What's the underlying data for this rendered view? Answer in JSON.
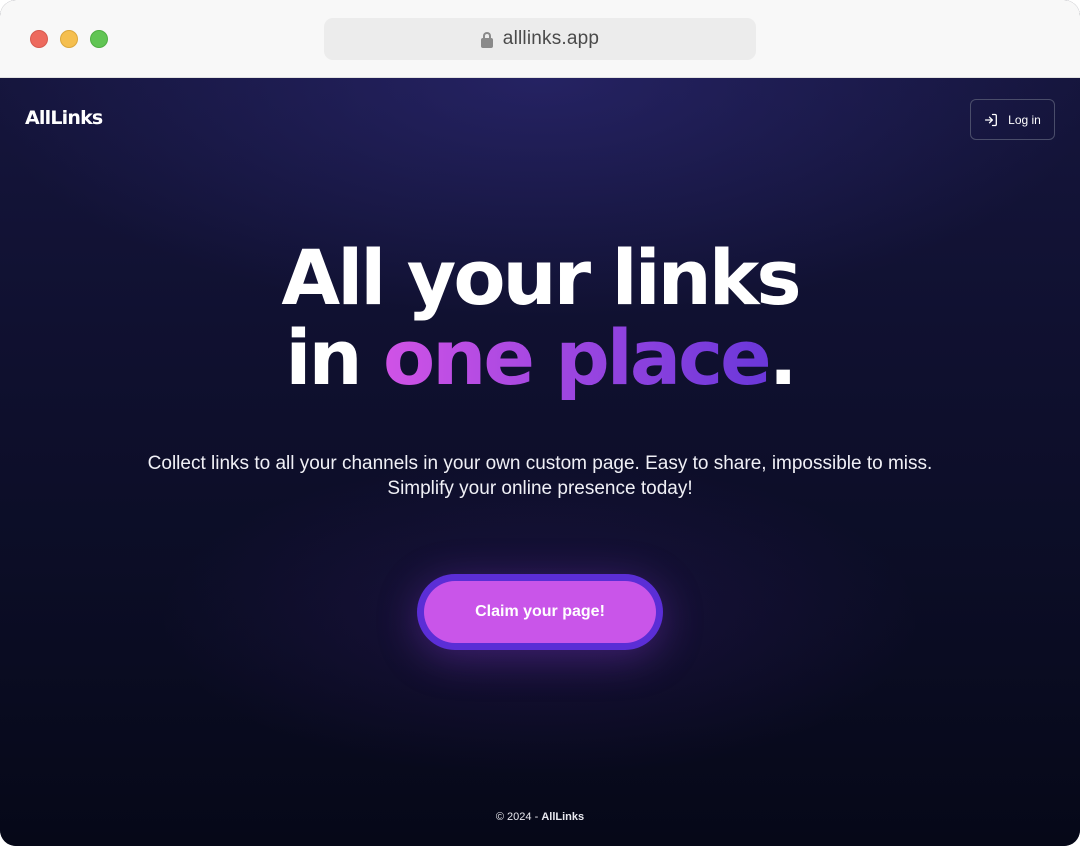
{
  "browser": {
    "url": "alllinks.app",
    "window_controls": [
      "close",
      "minimize",
      "maximize"
    ]
  },
  "header": {
    "logo": "AllLinks",
    "login_label": "Log in",
    "login_icon": "login-arrow-icon"
  },
  "hero": {
    "line1": "All your links",
    "line2_prefix": "in ",
    "line2_accent": "one place",
    "line2_suffix": ".",
    "accent_colors": [
      "#d053e6",
      "#6a37da"
    ]
  },
  "subtitle": {
    "line1": "Collect links to all your channels in your own custom page. Easy to share, impossible to miss.",
    "line2": "Simplify your online presence today!"
  },
  "cta": {
    "label": "Claim your page!",
    "color": "#c955e9",
    "ring_color": "#5b2ed6"
  },
  "footer": {
    "copyright": "© 2024 - ",
    "brand": "AllLinks"
  }
}
